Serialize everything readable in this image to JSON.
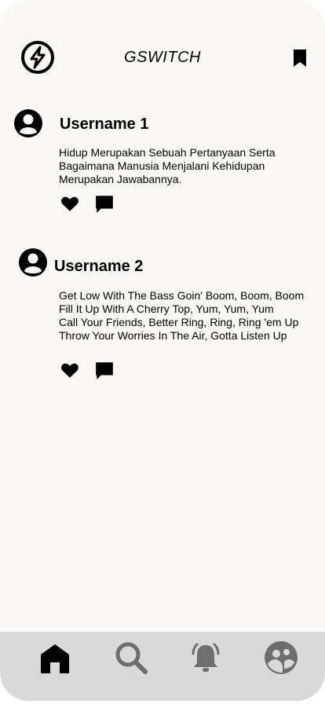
{
  "header": {
    "title": "GSWITCH",
    "logo_icon": "lightning-bolt-circle-icon",
    "bookmark_icon": "bookmark-icon"
  },
  "posts": [
    {
      "username": "Username 1",
      "text": "Hidup Merupakan Sebuah Pertanyaan Serta\nBagaimana Manusia Menjalani Kehidupan\nMerupakan Jawabannya."
    },
    {
      "username": "Username 2",
      "text": "Get Low With The Bass Goin' Boom, Boom, Boom\nFill It Up With A Cherry Top, Yum, Yum, Yum\nCall Your Friends, Better Ring, Ring, Ring 'em Up\nThrow Your Worries In The Air, Gotta Listen Up"
    }
  ],
  "bottom_nav": {
    "items": [
      "home-icon",
      "search-icon",
      "bell-icon",
      "profile-icon"
    ],
    "active": "home-icon",
    "active_color": "#000000",
    "inactive_color": "#6e6e6e",
    "background": "#d9d9d9"
  }
}
